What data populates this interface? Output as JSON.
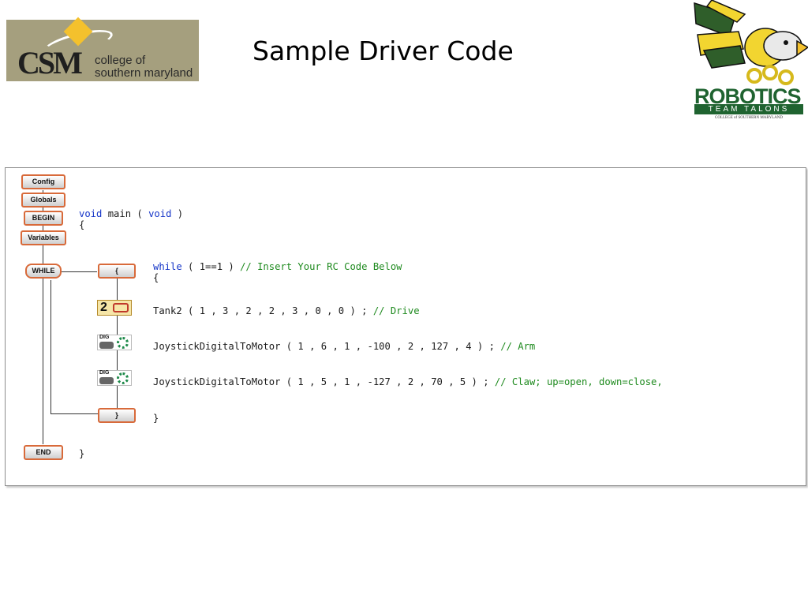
{
  "header": {
    "title": "Sample Driver Code",
    "csm_logo": {
      "letters": "CSM",
      "tagline_line1": "college of",
      "tagline_line2": "southern maryland"
    },
    "robotics_logo": {
      "word": "ROBOTICS",
      "team": "TEAM TALONS",
      "college": "COLLEGE of SOUTHERN MARYLAND"
    }
  },
  "blocks": {
    "config": "Config",
    "globals": "Globals",
    "begin": "BEGIN",
    "variables": "Variables",
    "while": "WHILE",
    "open_brace": "{",
    "close_brace": "}",
    "end": "END"
  },
  "icons": {
    "tank_number": "2",
    "joystick_label": "DIG"
  },
  "code": {
    "main_kw": "void",
    "main_text": " main ( ",
    "main_kw2": "void",
    "main_close": " )",
    "main_open_brace": "{",
    "while_kw": "while",
    "while_cond": " ( 1==1 ) ",
    "while_comment": "// Insert Your RC Code Below",
    "while_open_brace": "{",
    "tank_call": "Tank2 ( 1 , 3 , 2 , 2 , 3 , 0 , 0 ) ; ",
    "tank_comment": "// Drive",
    "arm_call": "JoystickDigitalToMotor ( 1 , 6 , 1 , -100 , 2 , 127 , 4 ) ; ",
    "arm_comment": "// Arm",
    "claw_call": "JoystickDigitalToMotor ( 1 , 5 , 1 , -127 , 2 , 70 , 5 ) ; ",
    "claw_comment": "// Claw; up=open, down=close,",
    "while_close_brace": "}",
    "main_close_brace": "}"
  },
  "colors": {
    "keyword": "#1535c8",
    "comment": "#1e8a1e",
    "block_border": "#d86a3a",
    "logo_bg": "#a59f7e",
    "robotics_green": "#1f6330"
  }
}
